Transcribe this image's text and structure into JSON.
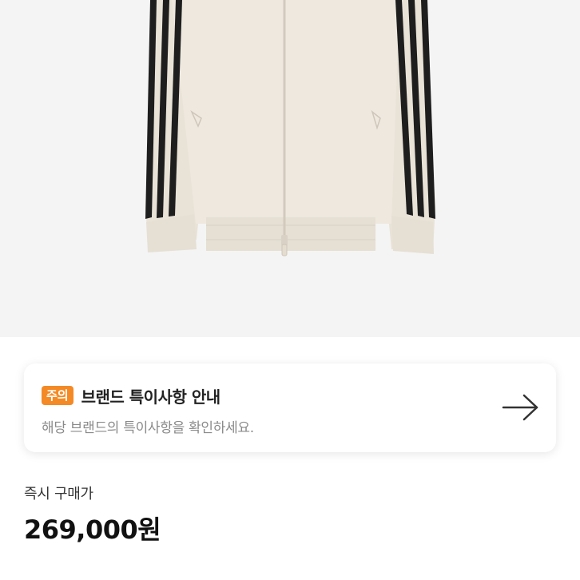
{
  "product": {
    "image_name": "track-jacket-image",
    "colors": {
      "jacket": "#ece6dc",
      "stripe": "#1e1e1e",
      "background": "#f4f4f4"
    }
  },
  "notice": {
    "badge": "주의",
    "title": "브랜드 특이사항 안내",
    "subtitle": "해당 브랜드의 특이사항을 확인하세요.",
    "arrow_icon": "arrow-right-icon",
    "badge_color": "#f48a25"
  },
  "price": {
    "label": "즉시 구매가",
    "value": "269,000원"
  }
}
